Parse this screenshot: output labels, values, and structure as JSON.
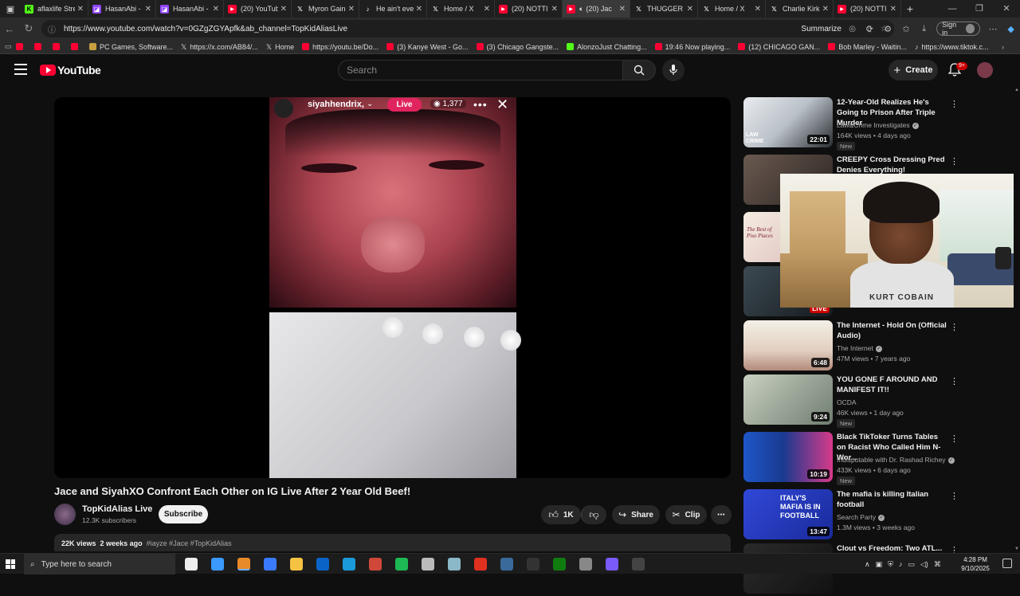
{
  "browser": {
    "tabs": [
      {
        "title": "aflaxlife Strea",
        "favicon": "K",
        "fav_color": "#53fc18",
        "active": false
      },
      {
        "title": "HasanAbi - ",
        "favicon": "twitch",
        "fav_color": "#9146ff",
        "active": false
      },
      {
        "title": "HasanAbi - ",
        "favicon": "twitch",
        "fav_color": "#9146ff",
        "active": false
      },
      {
        "title": "(20) YouTube",
        "favicon": "youtube",
        "fav_color": "#ff0033",
        "active": false
      },
      {
        "title": "Myron Gaines",
        "favicon": "X",
        "fav_color": "#000000",
        "active": false
      },
      {
        "title": "He ain't even",
        "favicon": "tiktok",
        "fav_color": "#000000",
        "active": false
      },
      {
        "title": "Home / X",
        "favicon": "X",
        "fav_color": "#000000",
        "active": false
      },
      {
        "title": "(20) NOTTI B",
        "favicon": "youtube",
        "fav_color": "#ff0033",
        "active": false
      },
      {
        "title": "(20) Jac",
        "favicon": "youtube",
        "fav_color": "#ff0033",
        "active": true
      },
      {
        "title": "THUGGER",
        "favicon": "X",
        "fav_color": "#000000",
        "active": false
      },
      {
        "title": "Home / X",
        "favicon": "X",
        "fav_color": "#000000",
        "active": false
      },
      {
        "title": "Charlie Kirk",
        "favicon": "X",
        "fav_color": "#000000",
        "active": false
      },
      {
        "title": "(20) NOTTI",
        "favicon": "youtube",
        "fav_color": "#ff0033",
        "active": false
      }
    ],
    "url": "https://www.youtube.com/watch?v=0GZgZGYApfk&ab_channel=TopKidAliasLive",
    "summarize_label": "Summarize",
    "signin_label": "Sign in",
    "bookmarks": [
      {
        "label": "",
        "icon": "youtube"
      },
      {
        "label": "",
        "icon": "youtube"
      },
      {
        "label": "",
        "icon": "youtube"
      },
      {
        "label": "",
        "icon": "youtube"
      },
      {
        "label": "PC Games, Software...",
        "icon": "game"
      },
      {
        "label": "https://x.com/AB84/...",
        "icon": "X"
      },
      {
        "label": "Home",
        "icon": "X"
      },
      {
        "label": "https://youtu.be/Do...",
        "icon": "youtube"
      },
      {
        "label": "(3) Kanye West - Go...",
        "icon": "youtube"
      },
      {
        "label": "(3) Chicago Gangste...",
        "icon": "youtube"
      },
      {
        "label": "AlonzoJust Chatting...",
        "icon": "kick"
      },
      {
        "label": "19:46 Now playing...",
        "icon": "youtube"
      },
      {
        "label": "(12) CHICAGO GAN...",
        "icon": "youtube"
      },
      {
        "label": "Bob Marley - Waitin...",
        "icon": "youtube"
      },
      {
        "label": "https://www.tiktok.c...",
        "icon": "tiktok"
      }
    ]
  },
  "youtube": {
    "logo_text": "YouTube",
    "search_placeholder": "Search",
    "create_label": "Create",
    "notification_badge": "9+",
    "player": {
      "live_username": "siyahhendrix,",
      "live_label": "Live",
      "viewer_count": "1,377"
    },
    "video": {
      "title": "Jace and SiyahXO Confront Each Other on IG Live After 2 Year Old Beef!",
      "channel": "TopKidAlias Live",
      "subscribers": "12.3K subscribers",
      "subscribe_label": "Subscribe",
      "likes": "1K",
      "share_label": "Share",
      "clip_label": "Clip",
      "views": "22K views",
      "age": "2 weeks ago",
      "tags": "#iayze #Jace #TopKidAlias"
    },
    "recommendations": [
      {
        "title": "12-Year-Old Realizes He's Going to Prison After Triple Murder",
        "channel": "Law&Crime Investigates",
        "verified": true,
        "meta": "164K views • 4 days ago",
        "badge": "New",
        "duration": "22:01"
      },
      {
        "title": "CREEPY Cross Dressing Pred Denies Everything!",
        "channel": "",
        "verified": false,
        "meta": "",
        "badge": "",
        "duration": ""
      },
      {
        "title": "",
        "channel": "",
        "verified": false,
        "meta": "",
        "badge": "",
        "duration": ""
      },
      {
        "title": "",
        "channel": "",
        "verified": false,
        "meta": "",
        "badge": "",
        "duration": "LIVE"
      },
      {
        "title": "The Internet - Hold On (Official Audio)",
        "channel": "The Internet",
        "verified": true,
        "meta": "47M views • 7 years ago",
        "badge": "",
        "duration": "6:48"
      },
      {
        "title": "YOU GONE F AROUND AND MANIFEST IT!!",
        "channel": "OCDA",
        "verified": false,
        "meta": "46K views • 1 day ago",
        "badge": "New",
        "duration": "9:24"
      },
      {
        "title": "Black TikToker Turns Tables on Racist Who Called Him N-Wor...",
        "channel": "Indisputable with Dr. Rashad Richey",
        "verified": true,
        "meta": "433K views • 6 days ago",
        "badge": "New",
        "duration": "10:19"
      },
      {
        "title": "The mafia is killing Italian football",
        "channel": "Search Party",
        "verified": true,
        "meta": "1.3M views • 3 weeks ago",
        "badge": "",
        "duration": "13:47"
      },
      {
        "title": "Clout vs Freedom: Two ATL...",
        "channel": "",
        "verified": false,
        "meta": "",
        "badge": "",
        "duration": ""
      }
    ],
    "thumb_texts": {
      "rec0_logo": "LAW CRIME",
      "rec2_text": "The Best of Piso Piaces",
      "rec7_text": "ITALY'S MAFIA IS IN FOOTBALL"
    }
  },
  "webcam": {
    "shirt_text": "KURT COBAIN"
  },
  "taskbar": {
    "search_placeholder": "Type here to search",
    "time": "4:28 PM",
    "date": "9/10/2025"
  }
}
